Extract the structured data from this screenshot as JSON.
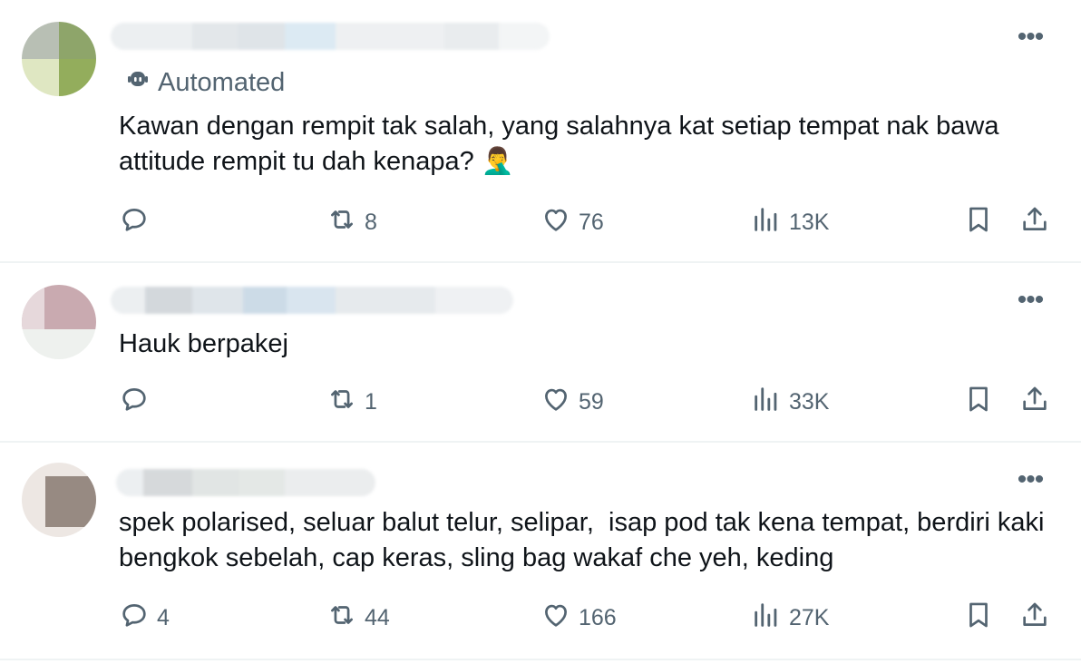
{
  "posts": [
    {
      "automated_label": "Automated",
      "text": "Kawan dengan rempit tak salah, yang salahnya kat setiap tempat nak bawa attitude rempit tu dah kenapa? 🤦‍♂️",
      "reply_count": "",
      "repost_count": "8",
      "like_count": "76",
      "view_count": "13K"
    },
    {
      "text": "Hauk berpakej",
      "reply_count": "",
      "repost_count": "1",
      "like_count": "59",
      "view_count": "33K"
    },
    {
      "text": "spek polarised, seluar balut telur, selipar,  isap pod tak kena tempat, berdiri kaki bengkok sebelah, cap keras, sling bag wakaf che yeh, keding",
      "reply_count": "4",
      "repost_count": "44",
      "like_count": "166",
      "view_count": "27K"
    }
  ],
  "icons": {
    "more": "more-dots-icon",
    "bot": "bot-icon",
    "reply": "reply-bubble-icon",
    "repost": "repost-arrows-icon",
    "like": "heart-icon",
    "views": "views-bars-icon",
    "bookmark": "bookmark-icon",
    "share": "share-upload-icon"
  },
  "colors": {
    "secondary_text": "#536471",
    "primary_text": "#0f1419",
    "divider": "#eff3f4"
  }
}
